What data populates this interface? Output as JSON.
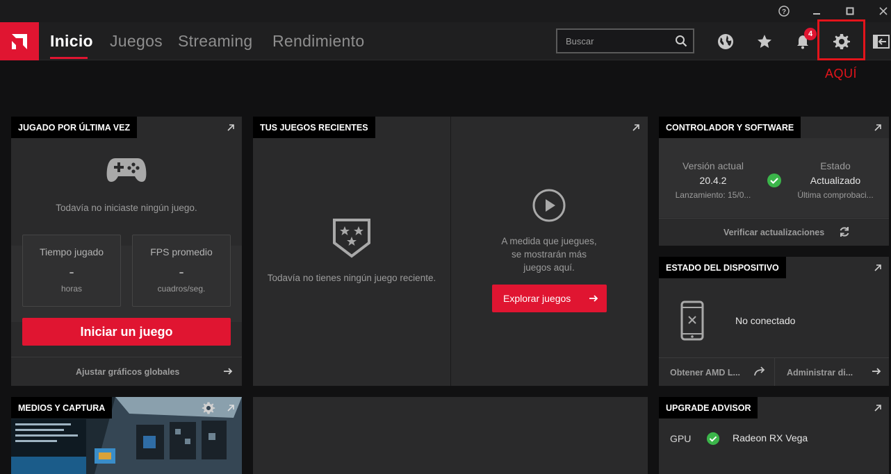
{
  "window": {
    "help_icon": "help-circle-icon",
    "minimize_icon": "minimize-icon",
    "maximize_icon": "maximize-icon",
    "close_icon": "close-icon"
  },
  "nav": {
    "tabs": [
      {
        "label": "Inicio",
        "active": true
      },
      {
        "label": "Juegos",
        "active": false
      },
      {
        "label": "Streaming",
        "active": false
      },
      {
        "label": "Rendimiento",
        "active": false
      }
    ],
    "search": {
      "placeholder": "Buscar"
    },
    "notification_count": "4"
  },
  "annotation": {
    "label": "AQUÍ",
    "color": "#e3141b"
  },
  "last_played": {
    "header": "JUGADO POR ÚLTIMA VEZ",
    "empty_text": "Todavía no iniciaste ningún juego.",
    "time": {
      "label": "Tiempo jugado",
      "value": "-",
      "unit": "horas"
    },
    "fps": {
      "label": "FPS promedio",
      "value": "-",
      "unit": "cuadros/seg."
    },
    "start_button": "Iniciar un juego",
    "footer_link": "Ajustar gráficos globales"
  },
  "recent_games": {
    "header": "TUS JUEGOS RECIENTES",
    "empty_text": "Todavía no tienes ningún juego reciente.",
    "promo_line1": "A medida que juegues,",
    "promo_line2": "se mostrarán más",
    "promo_line3": "juegos aquí.",
    "explore_button": "Explorar juegos"
  },
  "driver": {
    "header": "CONTROLADOR Y SOFTWARE",
    "version_label": "Versión actual",
    "version_value": "20.4.2",
    "release": "Lanzamiento: 15/0...",
    "status_label": "Estado",
    "status_value": "Actualizado",
    "last_check": "Última comprobaci...",
    "check_updates": "Verificar actualizaciones"
  },
  "device": {
    "header": "ESTADO DEL DISPOSITIVO",
    "status": "No conectado",
    "link1": "Obtener AMD L...",
    "link2": "Administrar di..."
  },
  "media": {
    "header": "MEDIOS Y CAPTURA"
  },
  "upgrade": {
    "header": "UPGRADE ADVISOR",
    "gpu_label": "GPU",
    "gpu_value": "Radeon RX Vega"
  },
  "colors": {
    "accent": "#e01531",
    "success": "#3bb54a",
    "panel": "#2a2a2b"
  }
}
